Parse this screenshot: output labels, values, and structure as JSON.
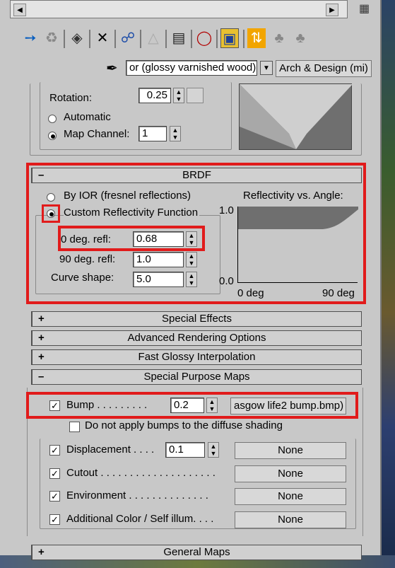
{
  "toolbar": {
    "icons": [
      "pick-material-icon",
      "put-to-scene-icon",
      "assign-material-icon",
      "reset-icon",
      "make-unique-icon",
      "put-to-library-icon",
      "material-effects-channel-icon",
      "show-map-icon",
      "show-end-result-icon",
      "go-to-parent-icon",
      "go-forward-icon"
    ]
  },
  "material": {
    "name_value": "or (glossy varnished wood)",
    "type_label": "Arch & Design (mi)"
  },
  "upper": {
    "rotation_label": "Rotation:",
    "rotation_value": "0.25",
    "automatic_label": "Automatic",
    "map_channel_label": "Map Channel:",
    "map_channel_value": "1"
  },
  "brdf": {
    "title": "BRDF",
    "by_ior_label": "By IOR (fresnel reflections)",
    "custom_label": "Custom Reflectivity Function",
    "zero_deg_label": "0 deg. refl:",
    "zero_deg_value": "0.68",
    "ninety_deg_label": "90 deg. refl:",
    "ninety_deg_value": "1.0",
    "curve_label": "Curve shape:",
    "curve_value": "5.0",
    "graph_title": "Reflectivity vs. Angle:",
    "y_top": "1.0",
    "y_bottom": "0.0",
    "x_left": "0 deg",
    "x_right": "90 deg"
  },
  "rollouts": {
    "special_effects": "Special Effects",
    "advanced_rendering": "Advanced Rendering Options",
    "fast_glossy": "Fast Glossy Interpolation",
    "special_purpose": "Special Purpose Maps",
    "general_maps": "General Maps"
  },
  "maps": {
    "bump_label": "Bump . . . . . . . . .",
    "bump_value": "0.2",
    "bump_map": "asgow life2 bump.bmp)",
    "no_diffuse_bump_label": "Do not apply bumps to the diffuse shading",
    "displacement_label": "Displacement . . . .",
    "displacement_value": "0.1",
    "displacement_map": "None",
    "cutout_label": "Cutout . . . . . . . . . . . . . . . . . . . .",
    "cutout_map": "None",
    "environment_label": "Environment . . . . . . . . . . . . . .",
    "environment_map": "None",
    "additional_label": "Additional Color / Self illum. . . .",
    "additional_map": "None"
  },
  "colors": {
    "highlight": "#e11b1b",
    "panel": "#c8c8c8"
  }
}
